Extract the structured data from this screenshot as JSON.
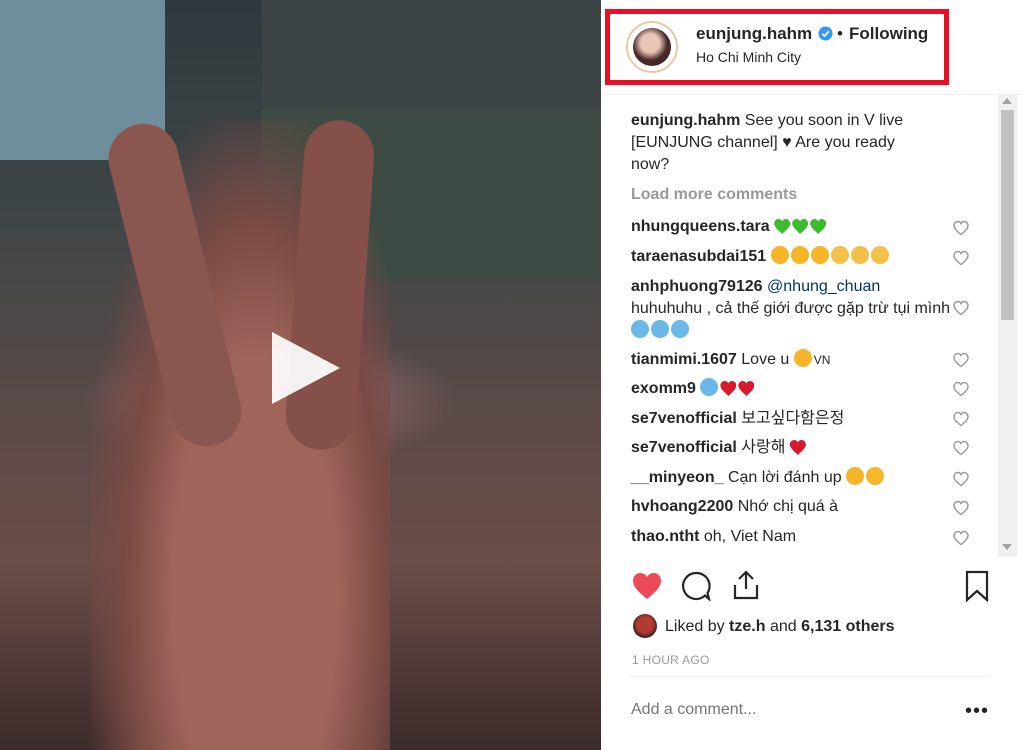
{
  "post": {
    "username": "eunjung.hahm",
    "separator": "•",
    "follow_label": "Following",
    "location": "Ho Chi Minh City",
    "caption_user": "eunjung.hahm",
    "caption_text": "See you soon in V live [EUNJUNG channel] ♥ Are you ready now?",
    "load_more": "Load more comments",
    "liked_by_prefix": "Liked by",
    "liked_by_user": "tze.h",
    "liked_by_and": "and",
    "liked_by_count": "6,131 others",
    "time": "1 HOUR AGO",
    "add_comment_placeholder": "Add a comment...",
    "more_label": "•••"
  },
  "comments": [
    {
      "user": "nhungqueens.tara",
      "text": "",
      "emojis": [
        "green-heart",
        "green-heart",
        "green-heart"
      ]
    },
    {
      "user": "taraenasubdai151",
      "text": "",
      "emojis": [
        "heart-eyes",
        "heart-eyes",
        "heart-eyes",
        "clap",
        "clap",
        "clap"
      ]
    },
    {
      "user": "anhphuong79126",
      "mention": "@nhung_chuan",
      "text": "huhuhuhu , cả thế giới được gặp trừ tụi mình",
      "emojis": [
        "crying",
        "crying",
        "crying"
      ]
    },
    {
      "user": "tianmimi.1607",
      "text": "Love u",
      "emojis": [
        "heart-eyes"
      ],
      "suffix": "VN"
    },
    {
      "user": "exomm9",
      "text": "",
      "emojis": [
        "crying",
        "red-heart",
        "red-heart"
      ]
    },
    {
      "user": "se7venofficial",
      "text": "보고싶다함은정",
      "emojis": []
    },
    {
      "user": "se7venofficial",
      "text": "사랑해",
      "emojis": [
        "red-heart"
      ]
    },
    {
      "user": "__minyeon_",
      "text": "Cạn lời đánh up",
      "emojis": [
        "heart-eyes",
        "laughing"
      ]
    },
    {
      "user": "hvhoang2200",
      "text": "Nhớ chị quá à",
      "emojis": []
    },
    {
      "user": "thao.ntht",
      "text": "oh, Viet Nam",
      "emojis": []
    }
  ],
  "colors": {
    "like_red": "#ed4956",
    "highlight": "#ea0f22",
    "verified_blue": "#3897f0",
    "text": "#262626",
    "muted": "#999999"
  }
}
